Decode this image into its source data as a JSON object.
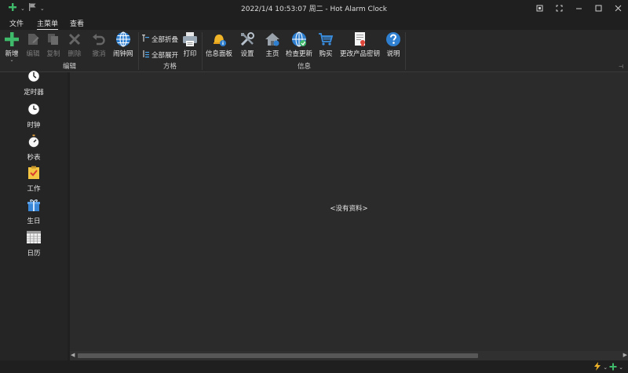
{
  "window": {
    "title": "2022/1/4 10:53:07 周二 - Hot Alarm Clock",
    "controls": [
      "restore-window",
      "focus",
      "minimize",
      "maximize",
      "close"
    ]
  },
  "quick_access": {
    "new_label": "+",
    "flag_label": "flag",
    "chevron": "⌄"
  },
  "tabs": [
    {
      "label": "文件",
      "active": false
    },
    {
      "label": "主菜单",
      "active": true
    },
    {
      "label": "查看",
      "active": false
    }
  ],
  "ribbon": {
    "groups": [
      {
        "label": "编辑"
      },
      {
        "label": "方格"
      },
      {
        "label": "信息"
      }
    ],
    "edit": {
      "new": "新增",
      "new_more": "⌄",
      "edit": "编辑",
      "copy": "复制",
      "delete": "删除",
      "undo": "撤消",
      "alarm_net": "闹钟网"
    },
    "grid": {
      "collapse_all": "全部折叠",
      "expand_all": "全部展开",
      "print": "打印"
    },
    "info": {
      "info_panel": "信息面板",
      "settings": "设置",
      "home": "主页",
      "check_updates": "检查更新",
      "buy": "购买",
      "change_key": "更改产品密钥",
      "help": "说明"
    },
    "pin": "⊣"
  },
  "nav": {
    "items": [
      {
        "label": "定时器",
        "icon": "timer-icon"
      },
      {
        "label": "时钟",
        "icon": "clock-icon"
      },
      {
        "label": "秒表",
        "icon": "stopwatch-icon"
      },
      {
        "label": "工作",
        "icon": "task-icon"
      },
      {
        "label": "生日",
        "icon": "gift-icon"
      },
      {
        "label": "日历",
        "icon": "calendar-icon"
      }
    ]
  },
  "content": {
    "empty_text": "<没有资料>"
  },
  "colors": {
    "accent_green": "#3fb96a",
    "accent_blue": "#2f7fd0",
    "background": "#2b2b2b"
  }
}
